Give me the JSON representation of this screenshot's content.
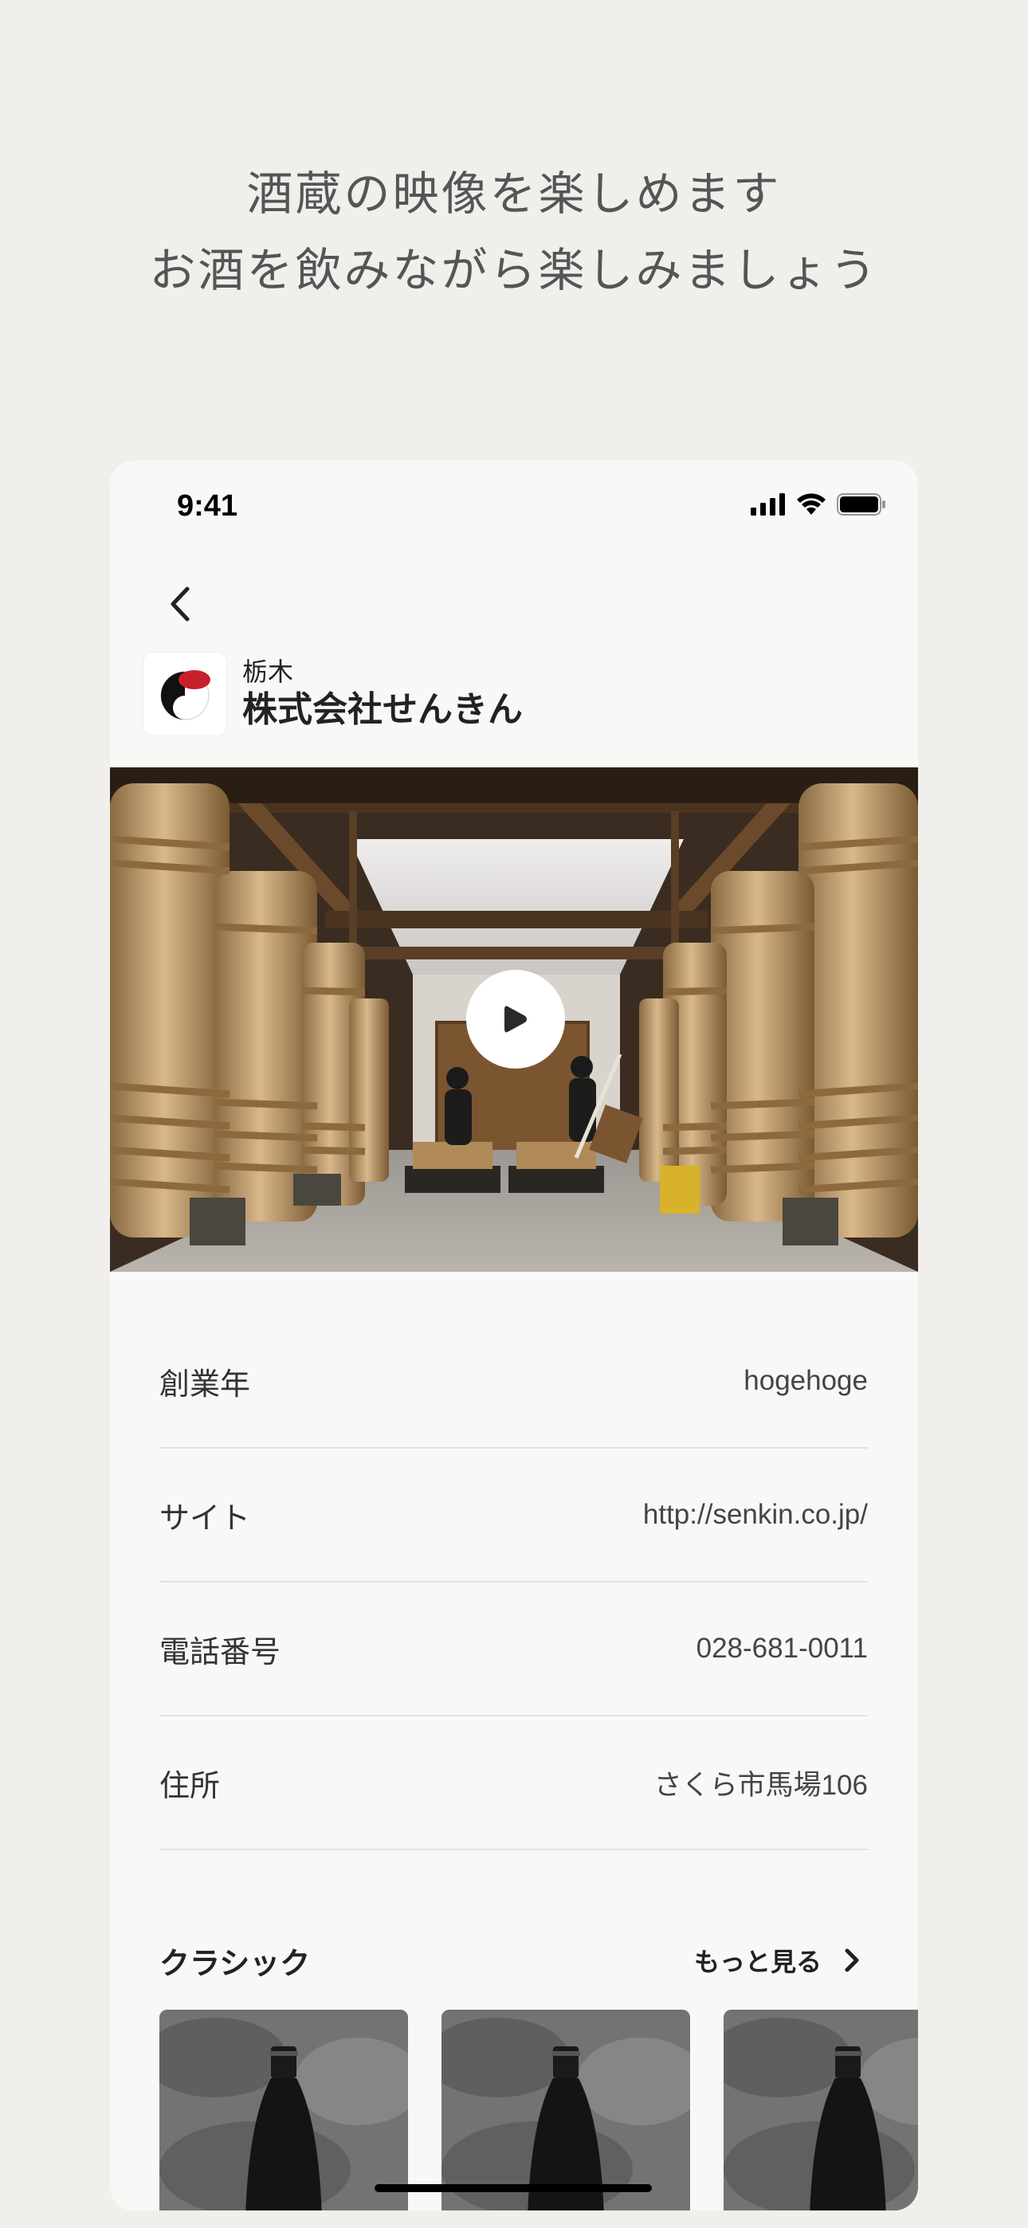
{
  "promo": {
    "line1": "酒蔵の映像を楽しめます",
    "line2": "お酒を飲みながら楽しみましょう"
  },
  "status_bar": {
    "time": "9:41"
  },
  "brewery": {
    "prefecture": "栃木",
    "name": "株式会社せんきん"
  },
  "info": [
    {
      "label": "創業年",
      "value": "hogehoge"
    },
    {
      "label": "サイト",
      "value": "http://senkin.co.jp/"
    },
    {
      "label": "電話番号",
      "value": "028-681-0011"
    },
    {
      "label": "住所",
      "value": "さくら市馬場106"
    }
  ],
  "section": {
    "title": "クラシック",
    "more_label": "もっと見る"
  },
  "colors": {
    "background": "#f0efec",
    "card": "#f8f8f7",
    "logo_red": "#c8202a",
    "text": "#222222"
  }
}
